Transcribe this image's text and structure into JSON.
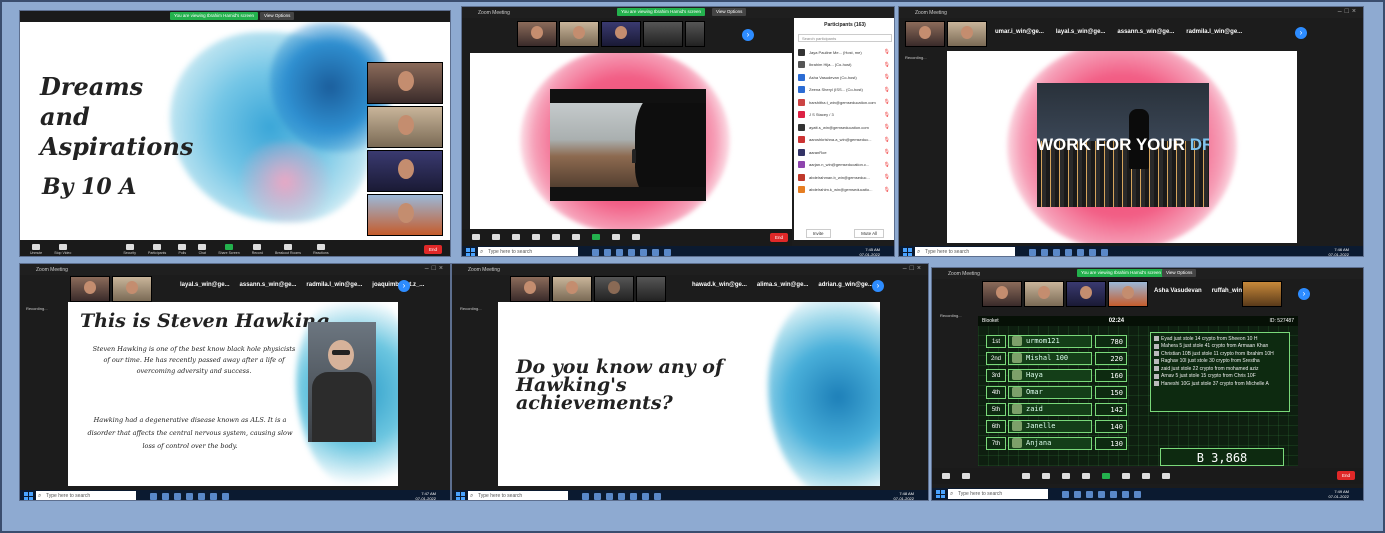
{
  "p1": {
    "banner": "You are viewing Ibrahim Hamid's screen",
    "view_options": "View Options",
    "slide_title": "Dreams and Aspirations",
    "slide_by": "By 10 A",
    "participants": [
      "Jaya Pauline Meriotta",
      "ACE Srinidhi Meriotta Go.",
      "Sufiya Sultan Ahmed",
      "Hasanne Iqbal"
    ],
    "toolbar": [
      "Unmute",
      "Stop Video",
      "Security",
      "Participants",
      "Polls",
      "Chat",
      "Share Screen",
      "Record",
      "Breakout Rooms",
      "Reactions"
    ],
    "end_label": "End"
  },
  "p2": {
    "title": "Zoom Meeting",
    "banner": "You are viewing Ibrahim Hamid's screen",
    "view_options": "View Options",
    "recording": "Recording...",
    "panel_title": "Participants (163)",
    "search_placeholder": "Search participants",
    "participants": [
      "Jaya Pauline Me... (Host, me)",
      "Ibrahim Hija... (Co-host)",
      "Asha Vasudevan (Co-host)",
      "Zeena Sheryl (ISS... (Co-host)",
      "harshitha.t_win@gemseducation.com",
      "J S Stacey / 3",
      "ayatt.s_win@gemseducation.com",
      "aaroshkrishna.a_win@gemseduc...",
      "aaranRoe",
      "aarjan.n_win@gemseducation.c...",
      "abdelrahman.b_win@gemseduc...",
      "abdelrahim.k_win@gemseducatio..."
    ],
    "invite": "Invite",
    "mute_all": "Mute All",
    "end_label": "End",
    "taskbar_search": "Type here to search",
    "time": "7:45 AM",
    "date": "07-01-2022"
  },
  "p3": {
    "title": "Zoom Meeting",
    "recording": "Recording...",
    "names": [
      "umar.i_win@ge...",
      "layal.s_win@ge...",
      "assann.s_win@ge...",
      "radmila.l_win@ge..."
    ],
    "video_text_1": "WORK FOR YOUR",
    "video_text_2": "DREAMS",
    "taskbar_search": "Type here to search",
    "time": "7:46 AM",
    "date": "07-01-2022"
  },
  "p4": {
    "title": "Zoom Meeting",
    "recording": "Recording...",
    "names": [
      "layal.s_win@ge...",
      "assann.s_win@ge...",
      "radmila.l_win@ge...",
      "joaquimbenet.z_..."
    ],
    "heading": "This is Steven Hawking",
    "para1": "Steven Hawking is one of the best know black hole physicists of our time. He has recently passed away after a life of overcoming adversity and success.",
    "para2": "Hawking had a degenerative disease known as ALS. It is a disorder that affects the central nervous system, causing slow loss of control over the body.",
    "taskbar_search": "Type here to search",
    "time": "7:47 AM",
    "date": "07-01-2022"
  },
  "p5": {
    "title": "Zoom Meeting",
    "recording": "Recording...",
    "names": [
      "hawad.k_win@ge...",
      "alima.s_win@ge...",
      "adrian.g_win@ge..."
    ],
    "slide_text": "Do you know any of Hawking's achievements?",
    "taskbar_search": "Type here to search",
    "time": "7:48 AM",
    "date": "07-01-2022"
  },
  "p6": {
    "title": "Zoom Meeting",
    "banner": "You are viewing Ibrahim Hamid's screen",
    "view_options": "View Options",
    "names": [
      "Asha Vasudevan",
      "ruffah_win@ge..."
    ],
    "recording": "Recording...",
    "game_name": "Blooket",
    "timer": "02:24",
    "game_id": "ID: 527487",
    "leaderboard": [
      {
        "rank": "1st",
        "name": "urmom121",
        "score": "780"
      },
      {
        "rank": "2nd",
        "name": "Mishal 100",
        "score": "220"
      },
      {
        "rank": "3rd",
        "name": "Haya",
        "score": "160"
      },
      {
        "rank": "4th",
        "name": "Omar",
        "score": "150"
      },
      {
        "rank": "5th",
        "name": "zaid",
        "score": "142"
      },
      {
        "rank": "6th",
        "name": "Janelle",
        "score": "140"
      },
      {
        "rank": "7th",
        "name": "Anjana",
        "score": "130"
      }
    ],
    "feed": [
      "Eyad just stole 14 crypto from Sheeon 10 H",
      "Mahera 5 just stole 41 crypto from Armaan Khan",
      "Christian 10B just stole 11 crypto from Ibrahim 10H",
      "Raghav 10I just stole 30 crypto from Srestha",
      "zaid just stole 22 crypto from mohamed aziz",
      "Arnav 5 just stole 15 crypto from Chris 10F",
      "Haneshi 10G just stole 37 crypto from Michelle A"
    ],
    "crypto_total": "B 3,868",
    "end_label": "End",
    "taskbar_search": "Type here to search",
    "time": "7:49 AM",
    "date": "07-01-2022"
  }
}
